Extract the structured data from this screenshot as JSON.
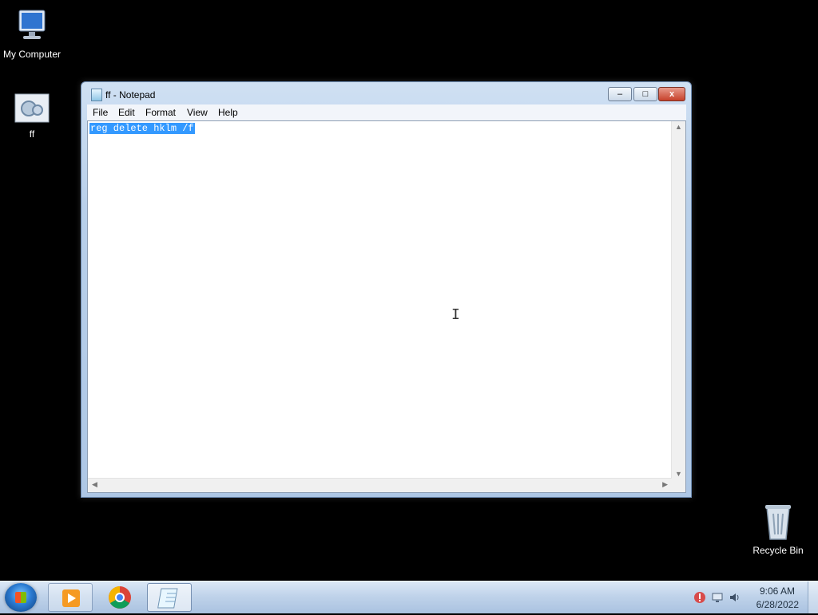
{
  "desktop": {
    "icons": [
      {
        "label": "My Computer",
        "icon": "computer-icon"
      },
      {
        "label": "ff",
        "icon": "settings-gear-file-icon"
      },
      {
        "label": "Recycle Bin",
        "icon": "recycle-bin-icon"
      }
    ]
  },
  "window": {
    "title": "ff - Notepad",
    "controls": {
      "minimize": "–",
      "maximize": "□",
      "close": "x"
    },
    "menu": [
      "File",
      "Edit",
      "Format",
      "View",
      "Help"
    ],
    "content_lines": [
      "reg delete hklm /f"
    ],
    "selection": "reg delete hklm /f"
  },
  "taskbar": {
    "start_icon": "windows-start-orb-icon",
    "apps": [
      {
        "name": "Windows Media Player",
        "icon": "media-player-icon"
      },
      {
        "name": "Google Chrome",
        "icon": "chrome-icon"
      },
      {
        "name": "Notepad",
        "icon": "notepad-icon"
      }
    ],
    "tray": {
      "icons": [
        "network-warning-icon",
        "display-network-icon",
        "volume-icon"
      ],
      "time": "9:06 AM",
      "date": "6/28/2022"
    }
  },
  "colors": {
    "desktop_bg": "#000000",
    "selection_bg": "#3399ff",
    "taskbar_bg": "#c0d3ea"
  }
}
